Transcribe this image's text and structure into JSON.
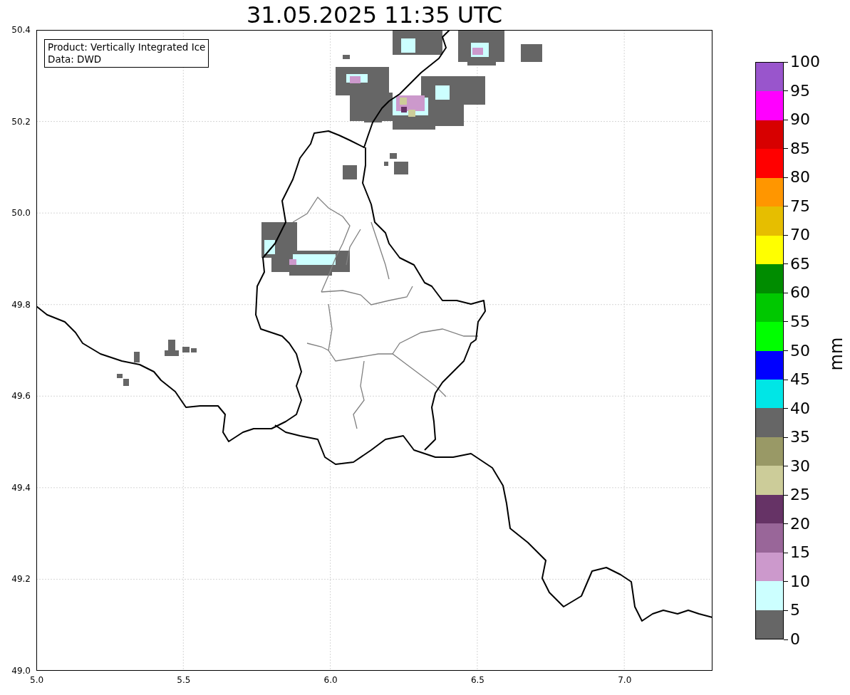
{
  "title": "31.05.2025 11:35 UTC",
  "info_box": [
    "Product: Vertically Integrated Ice",
    "Data: DWD"
  ],
  "y_ticks": [
    "50.4",
    "50.2",
    "50.0",
    "49.8",
    "49.6",
    "49.4",
    "49.2",
    "49.0"
  ],
  "x_ticks": [
    "5.0",
    "5.5",
    "6.0",
    "6.5",
    "7.0"
  ],
  "colorbar": {
    "label": "mm",
    "ticks": [
      "100",
      "95",
      "90",
      "85",
      "80",
      "75",
      "70",
      "65",
      "60",
      "55",
      "50",
      "45",
      "40",
      "35",
      "30",
      "25",
      "20",
      "15",
      "10",
      "5",
      "0"
    ],
    "bins": [
      {
        "color": "#9955cc"
      },
      {
        "color": "#ff00ff"
      },
      {
        "color": "#d70000"
      },
      {
        "color": "#ff0000"
      },
      {
        "color": "#ff9600"
      },
      {
        "color": "#e6be00"
      },
      {
        "color": "#ffff00"
      },
      {
        "color": "#008c00"
      },
      {
        "color": "#00c800"
      },
      {
        "color": "#00ff00"
      },
      {
        "color": "#0000ff"
      },
      {
        "color": "#00e6e6"
      },
      {
        "color": "#666666"
      },
      {
        "color": "#999966"
      },
      {
        "color": "#cccc99"
      },
      {
        "color": "#663366"
      },
      {
        "color": "#996699"
      },
      {
        "color": "#cc99cc"
      },
      {
        "color": "#ccffff"
      },
      {
        "color": "#666666"
      }
    ]
  }
}
